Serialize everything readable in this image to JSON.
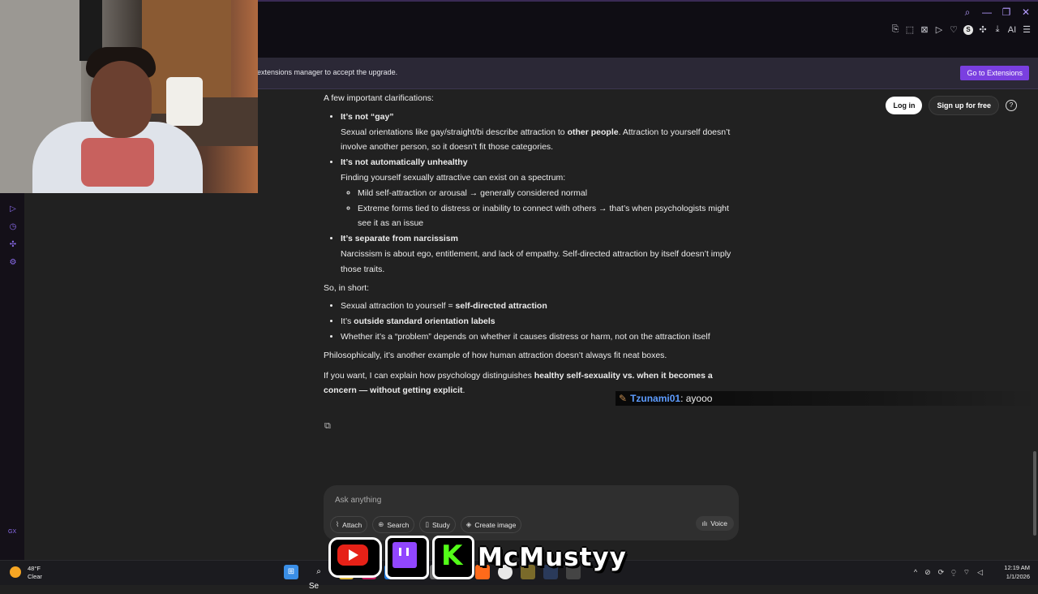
{
  "browser": {
    "window_controls": [
      "search-icon",
      "minimize-icon",
      "restore-icon",
      "close-icon"
    ],
    "toolbar_icons": [
      "bookmark-icon",
      "snapshot-icon",
      "extensions-icon",
      "play-icon",
      "heart-icon",
      "s-icon",
      "puzzle-icon",
      "download-icon",
      "ai-icon",
      "menu-icon"
    ],
    "ai_label": "AI",
    "s_label": "S"
  },
  "banner": {
    "text": "extensions manager to accept the upgrade.",
    "button_label": "Go to Extensions"
  },
  "leftrail": {
    "gx_label": "GX"
  },
  "header": {
    "login_label": "Log in",
    "signup_label": "Sign up for free",
    "help_label": "?"
  },
  "response": {
    "intro": "A few important clarifications:",
    "b1_title": "It’s not “gay”",
    "b1_text_a": "Sexual orientations like gay/straight/bi describe attraction to ",
    "b1_bold": "other people",
    "b1_text_b": ". Attraction to yourself doesn’t involve another person, so it doesn’t fit those categories.",
    "b2_title": "It’s not automatically unhealthy",
    "b2_text": "Finding yourself sexually attractive can exist on a spectrum:",
    "b2_sub1": "Mild self-attraction or arousal → generally considered normal",
    "b2_sub2": "Extreme forms tied to distress or inability to connect with others → that’s when psychologists might see it as an issue",
    "b3_title": "It’s separate from narcissism",
    "b3_text": "Narcissism is about ego, entitlement, and lack of empathy. Self-directed attraction by itself doesn’t imply those traits.",
    "short_intro": "So, in short:",
    "s1_a": "Sexual attraction to yourself = ",
    "s1_bold": "self-directed attraction",
    "s2_a": "It’s ",
    "s2_bold": "outside standard orientation labels",
    "s3": "Whether it’s a “problem” depends on whether it causes distress or harm, not on the attraction itself",
    "philo": "Philosophically, it’s another example of how human attraction doesn’t always fit neat boxes.",
    "offer_a": "If you want, I can explain how psychology distinguishes ",
    "offer_bold": "healthy self-sexuality vs. when it becomes a concern — without getting explicit",
    "offer_b": "."
  },
  "overlay_chat": {
    "username": "Tzunami01",
    "message": ": ayooo"
  },
  "composer": {
    "placeholder": "Ask anything",
    "attach": "Attach",
    "search": "Search",
    "study": "Study",
    "create_image": "Create image",
    "voice": "Voice"
  },
  "stream_brand": {
    "name": "McMustyy"
  },
  "taskbar": {
    "temp": "48°F",
    "condition": "Clear",
    "search_label": "Se",
    "time": "12:19 AM",
    "date": "1/1/2026"
  }
}
